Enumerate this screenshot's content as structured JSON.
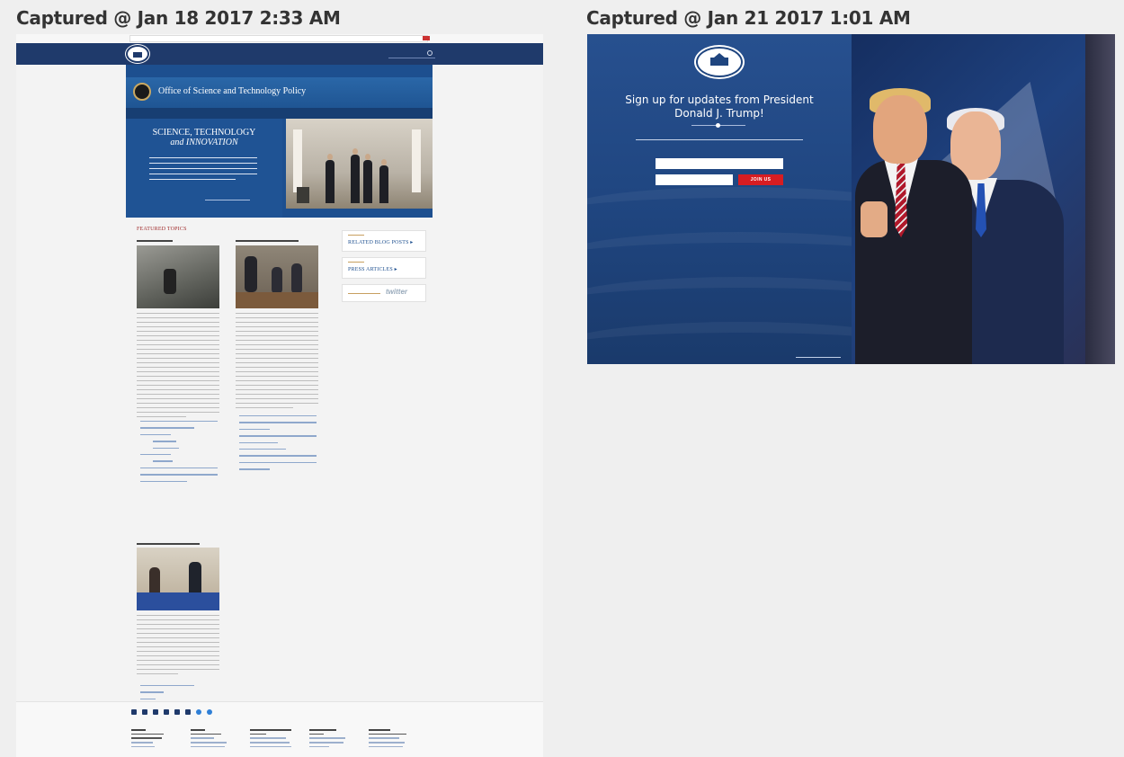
{
  "captions": {
    "left": "Captured @ Jan 18 2017 2:33 AM",
    "right": "Captured @ Jan 21 2017 1:01 AM"
  },
  "old_site": {
    "office_title": "Office of Science and Technology Policy",
    "hero_heading_line1": "SCIENCE, TECHNOLOGY",
    "hero_heading_line2": "and INNOVATION",
    "featured_heading": "FEATURED TOPICS",
    "side_box_1": "RELATED BLOG POSTS ▸",
    "side_box_2": "PRESS ARTICLES ▸",
    "twitter_word": "twitter"
  },
  "new_site": {
    "signup_title": "Sign up for updates from President Donald J. Trump!",
    "join_button": "JOIN US"
  },
  "colors": {
    "navy": "#1f3a6b",
    "join_red": "#d71d22"
  }
}
